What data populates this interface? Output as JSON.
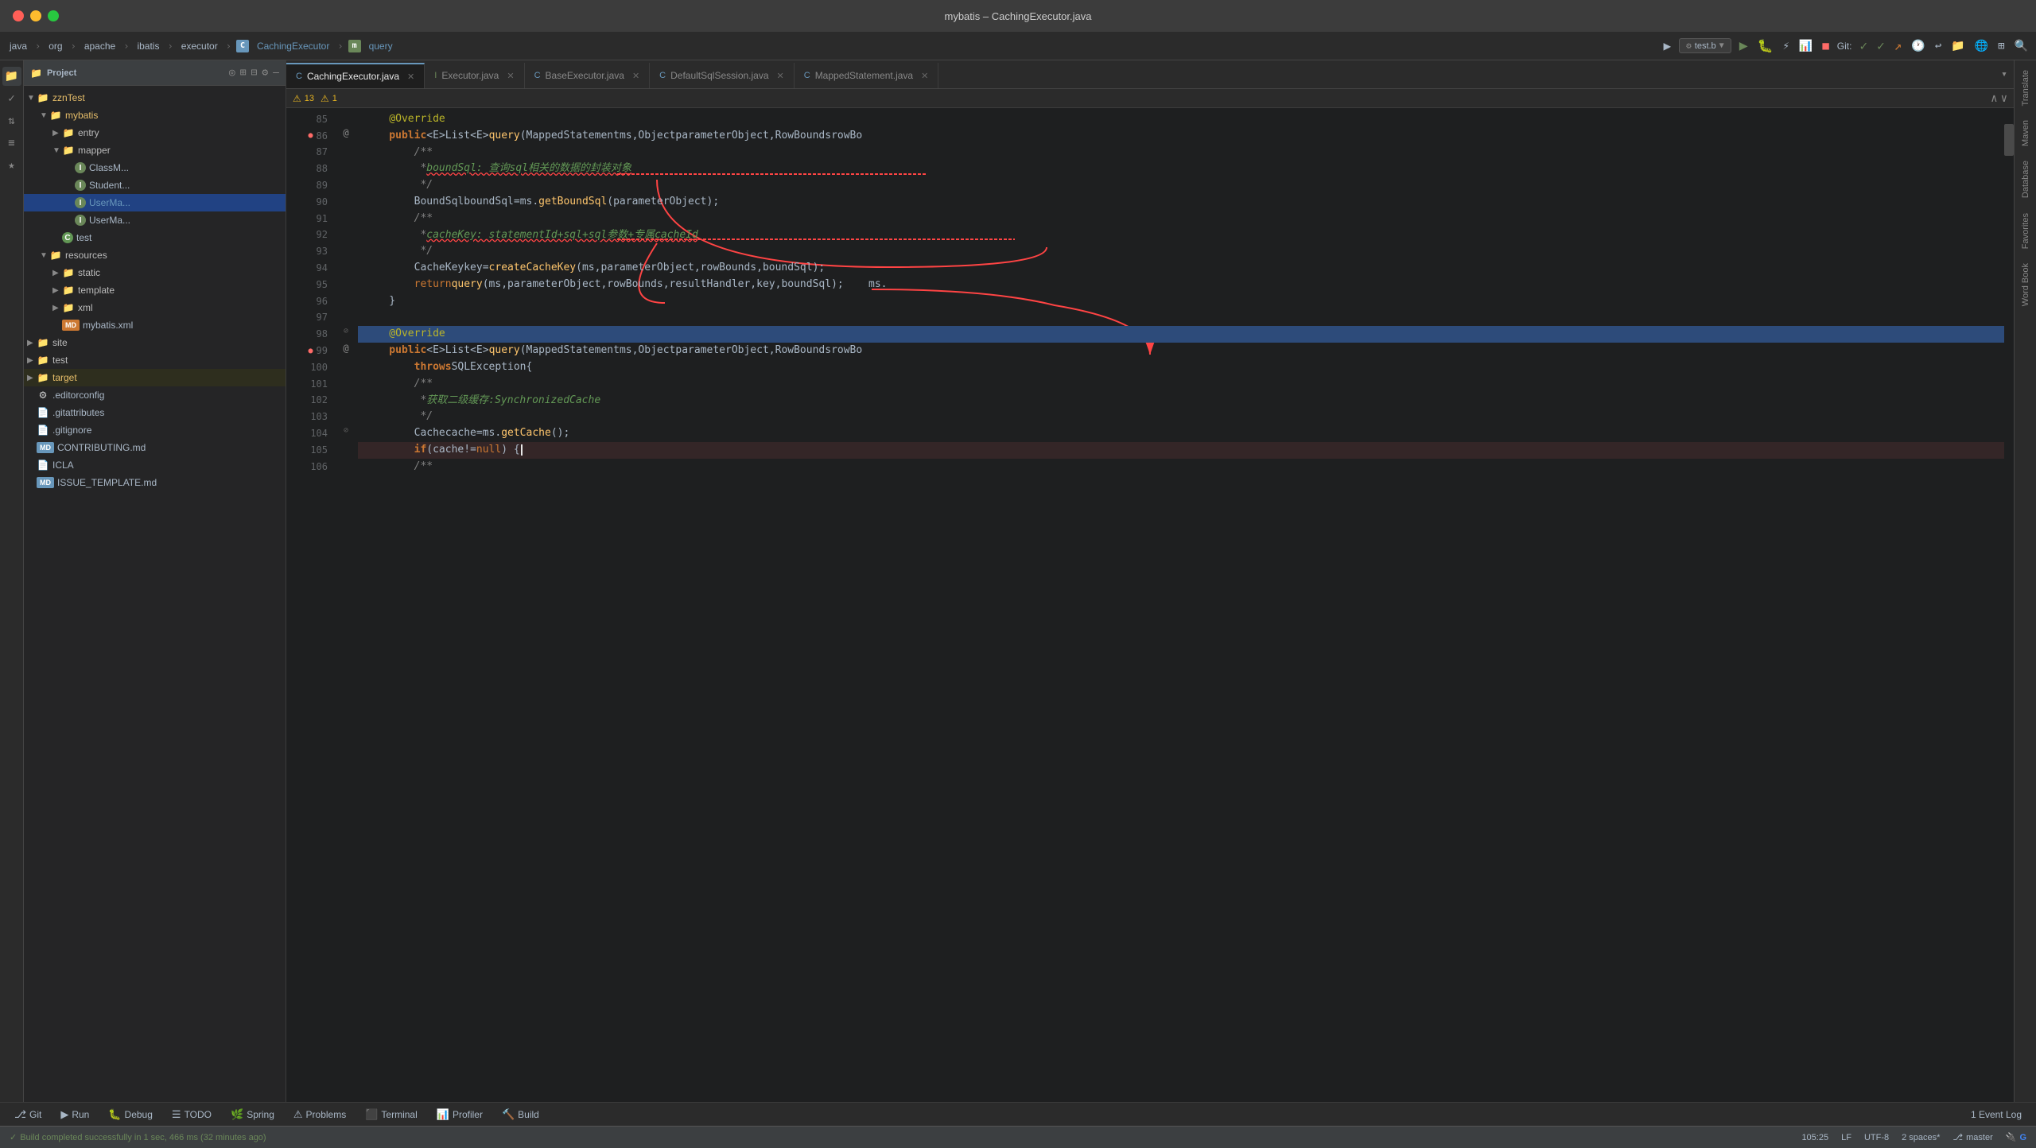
{
  "window": {
    "title": "mybatis – CachingExecutor.java"
  },
  "titlebar": {
    "close": "●",
    "minimize": "●",
    "maximize": "●"
  },
  "breadcrumb": {
    "items": [
      "java",
      "org",
      "apache",
      "ibatis",
      "executor",
      "CachingExecutor",
      "query"
    ]
  },
  "toolbar": {
    "git_label": "Git:",
    "test_b": "test.b"
  },
  "tabs": [
    {
      "label": "CachingExecutor.java",
      "icon": "C",
      "icon_color": "blue",
      "active": true
    },
    {
      "label": "Executor.java",
      "icon": "I",
      "icon_color": "green",
      "active": false
    },
    {
      "label": "BaseExecutor.java",
      "icon": "C",
      "icon_color": "blue",
      "active": false
    },
    {
      "label": "DefaultSqlSession.java",
      "icon": "C",
      "icon_color": "blue",
      "active": false
    },
    {
      "label": "MappedStatement.java",
      "icon": "C",
      "icon_color": "blue",
      "active": false
    }
  ],
  "warnings": {
    "warn_icon": "⚠",
    "warn_count": "13",
    "err_icon": "⚠",
    "err_count": "1"
  },
  "tree": {
    "header": "Project",
    "items": [
      {
        "indent": 0,
        "type": "folder",
        "label": "zznTest",
        "expanded": true
      },
      {
        "indent": 1,
        "type": "folder",
        "label": "mybatis",
        "expanded": true
      },
      {
        "indent": 2,
        "type": "folder",
        "label": "entry",
        "expanded": false
      },
      {
        "indent": 2,
        "type": "folder",
        "label": "mapper",
        "expanded": true
      },
      {
        "indent": 3,
        "type": "java",
        "badge": "I",
        "label": "ClassM..."
      },
      {
        "indent": 3,
        "type": "java",
        "badge": "I",
        "label": "Student..."
      },
      {
        "indent": 3,
        "type": "java-selected",
        "badge": "I",
        "label": "UserMa..."
      },
      {
        "indent": 3,
        "type": "java",
        "badge": "I",
        "label": "UserMa..."
      },
      {
        "indent": 2,
        "type": "test",
        "badge": "C",
        "label": "test"
      },
      {
        "indent": 1,
        "type": "folder",
        "label": "resources",
        "expanded": true
      },
      {
        "indent": 2,
        "type": "folder",
        "label": "static",
        "expanded": false
      },
      {
        "indent": 2,
        "type": "folder",
        "label": "template",
        "expanded": false
      },
      {
        "indent": 2,
        "type": "folder",
        "label": "xml",
        "expanded": false
      },
      {
        "indent": 2,
        "type": "xml",
        "label": "mybatis.xml"
      },
      {
        "indent": 0,
        "type": "folder",
        "label": "site",
        "expanded": false
      },
      {
        "indent": 0,
        "type": "folder",
        "label": "test",
        "expanded": false
      },
      {
        "indent": 0,
        "type": "folder-orange",
        "label": "target",
        "expanded": false,
        "selected": true
      },
      {
        "indent": 0,
        "type": "file",
        "label": ".editorconfig"
      },
      {
        "indent": 0,
        "type": "file",
        "label": ".gitattributes"
      },
      {
        "indent": 0,
        "type": "file",
        "label": ".gitignore"
      },
      {
        "indent": 0,
        "type": "md",
        "label": "CONTRIBUTING.md"
      },
      {
        "indent": 0,
        "type": "file",
        "label": "ICLA"
      },
      {
        "indent": 0,
        "type": "md",
        "label": "ISSUE_TEMPLATE.md"
      }
    ]
  },
  "code_lines": [
    {
      "num": 85,
      "content": "    @Override",
      "class": "annotation-line"
    },
    {
      "num": 86,
      "content": "    public <E> List<E> query(MappedStatement ms, Object parameterObject, RowBounds rowBo",
      "class": ""
    },
    {
      "num": 87,
      "content": "        /**",
      "class": ""
    },
    {
      "num": 88,
      "content": "         * boundSql: 查询sql相关的数据的封装对象",
      "class": ""
    },
    {
      "num": 89,
      "content": "         */",
      "class": ""
    },
    {
      "num": 90,
      "content": "        BoundSql boundSql = ms.getBoundSql(parameterObject);",
      "class": ""
    },
    {
      "num": 91,
      "content": "        /**",
      "class": ""
    },
    {
      "num": 92,
      "content": "         * cacheKey: statementId+sql+sql参数+专属cacheId",
      "class": ""
    },
    {
      "num": 93,
      "content": "         */",
      "class": ""
    },
    {
      "num": 94,
      "content": "        CacheKey key = createCacheKey(ms, parameterObject, rowBounds, boundSql);",
      "class": ""
    },
    {
      "num": 95,
      "content": "        return query(ms, parameterObject, rowBounds, resultHandler, key, boundSql);    ms.",
      "class": ""
    },
    {
      "num": 96,
      "content": "    }",
      "class": ""
    },
    {
      "num": 97,
      "content": "",
      "class": ""
    },
    {
      "num": 98,
      "content": "    @Override",
      "class": "highlighted"
    },
    {
      "num": 99,
      "content": "    public <E> List<E> query(MappedStatement ms, Object parameterObject, RowBounds rowBo",
      "class": ""
    },
    {
      "num": 100,
      "content": "            throws SQLException {",
      "class": ""
    },
    {
      "num": 101,
      "content": "        /**",
      "class": ""
    },
    {
      "num": 102,
      "content": "         * 获取二级缓存: SynchronizedCache",
      "class": ""
    },
    {
      "num": 103,
      "content": "         */",
      "class": ""
    },
    {
      "num": 104,
      "content": "        Cache cache = ms.getCache();",
      "class": ""
    },
    {
      "num": 105,
      "content": "        if (cache != null) {",
      "class": "error-line"
    },
    {
      "num": 106,
      "content": "            /**",
      "class": ""
    }
  ],
  "right_tabs": [
    "Translate",
    "Maven",
    "Database",
    "Favorites",
    "Word Book"
  ],
  "bottom_tabs": [
    {
      "icon": "⎇",
      "label": "Git"
    },
    {
      "icon": "▶",
      "label": "Run"
    },
    {
      "icon": "🐛",
      "label": "Debug"
    },
    {
      "icon": "☰",
      "label": "TODO"
    },
    {
      "icon": "🌿",
      "label": "Spring"
    },
    {
      "icon": "⚠",
      "label": "Problems"
    },
    {
      "icon": "⬛",
      "label": "Terminal"
    },
    {
      "icon": "📊",
      "label": "Profiler"
    },
    {
      "icon": "🔨",
      "label": "Build"
    }
  ],
  "status_bar": {
    "build_status": "Build completed successfully in 1 sec, 466 ms (32 minutes ago)",
    "cursor_pos": "105:25",
    "line_ending": "LF",
    "encoding": "UTF-8",
    "indent": "2 spaces*",
    "branch": "master",
    "event_log": "1  Event Log"
  }
}
